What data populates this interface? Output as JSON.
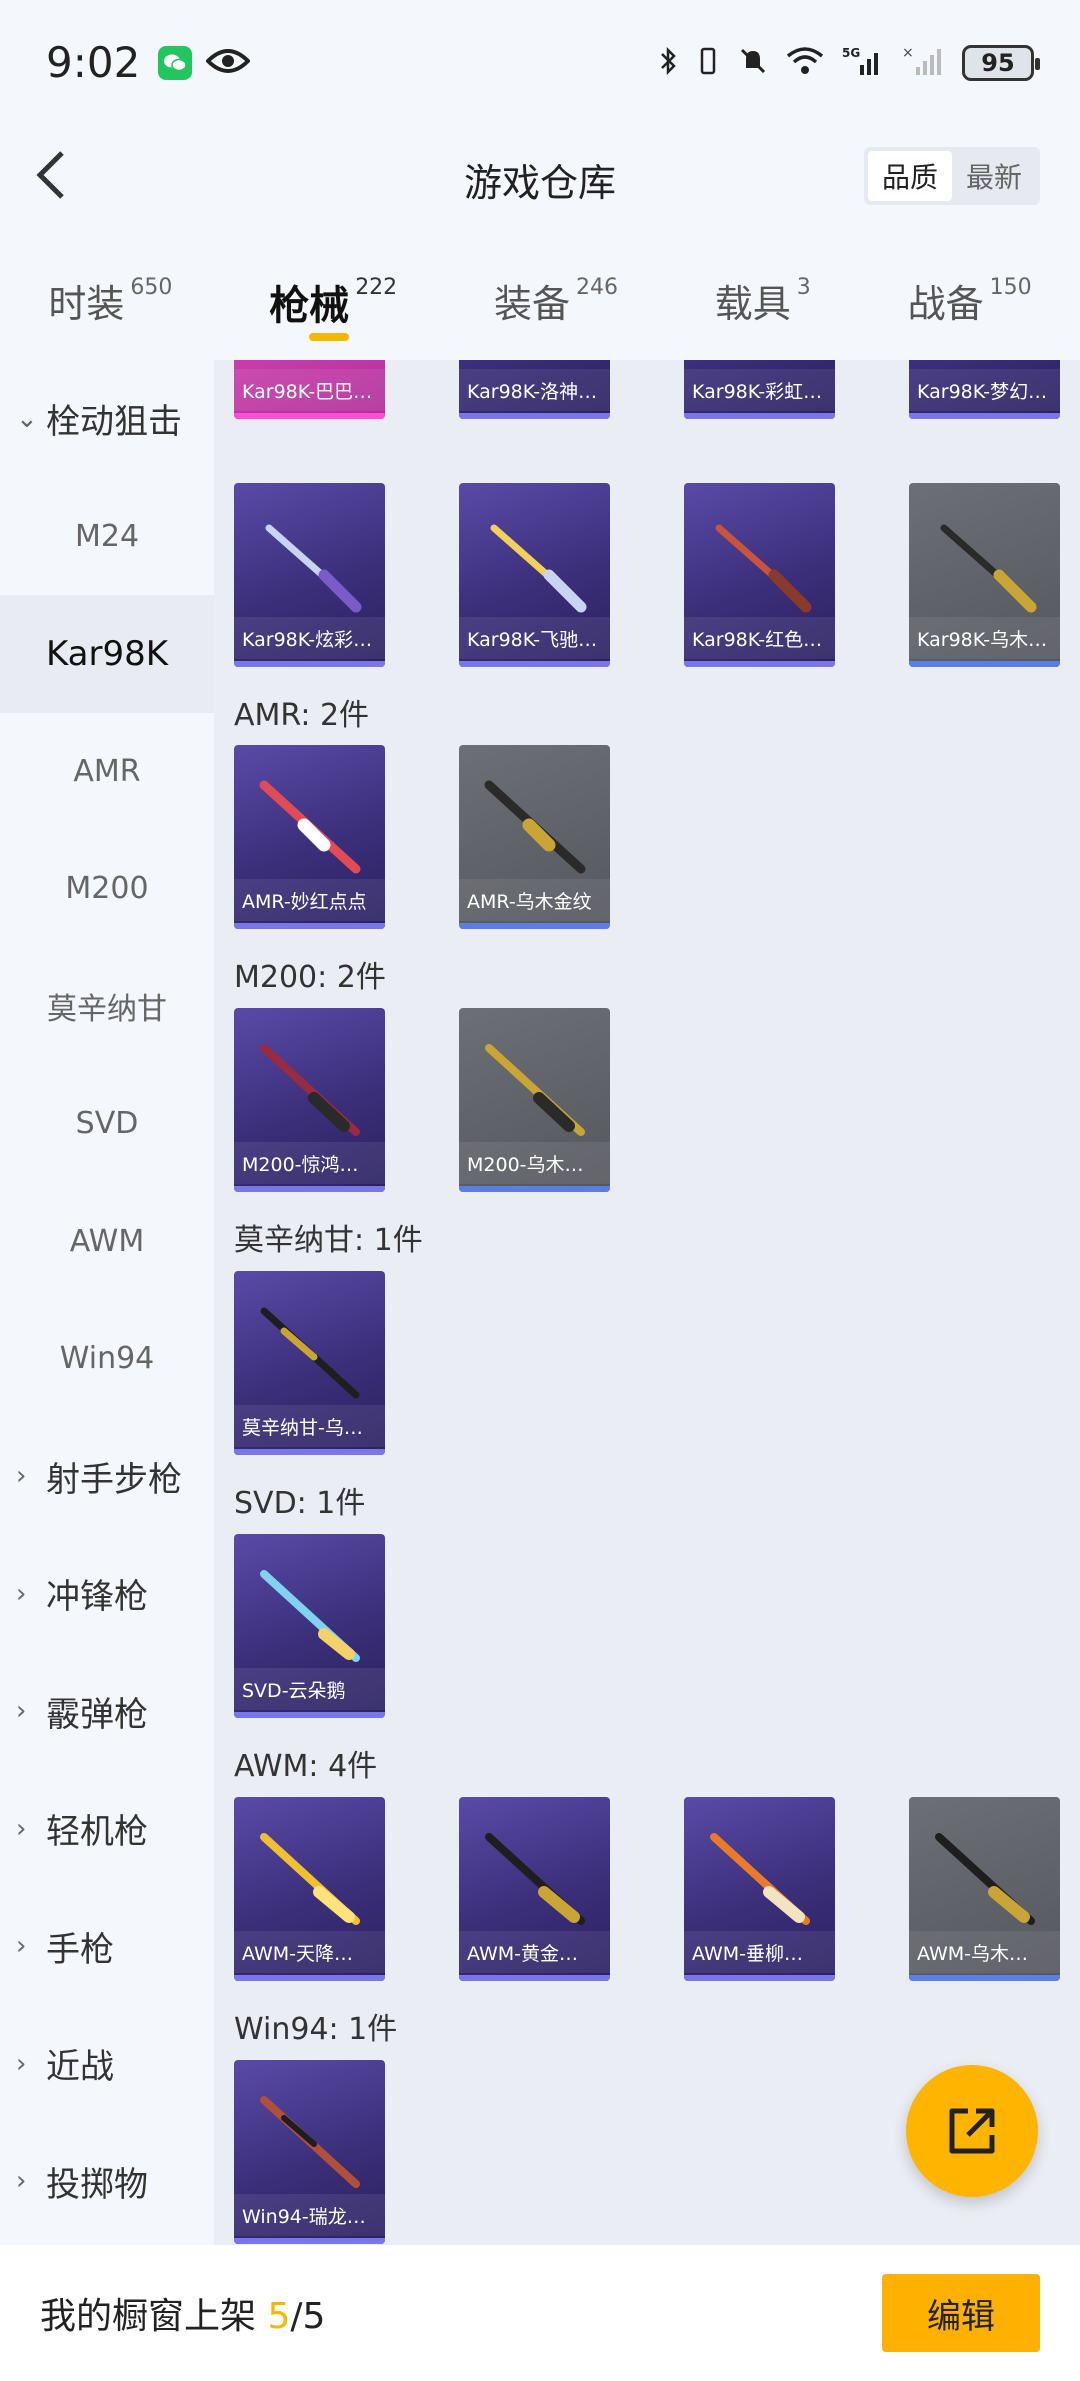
{
  "status_bar": {
    "time": "9:02",
    "battery": "95",
    "network": "5G"
  },
  "header": {
    "title": "游戏仓库",
    "sort_quality": "品质",
    "sort_newest": "最新"
  },
  "tabs": [
    {
      "label": "时装",
      "count": "650"
    },
    {
      "label": "枪械",
      "count": "222"
    },
    {
      "label": "装备",
      "count": "246"
    },
    {
      "label": "载具",
      "count": "3"
    },
    {
      "label": "战备",
      "count": "150"
    }
  ],
  "sidebar": {
    "group": "栓动狙击",
    "items": [
      "M24",
      "Kar98K",
      "AMR",
      "M200",
      "莫辛纳甘",
      "SVD",
      "AWM",
      "Win94"
    ],
    "groups": [
      "射手步枪",
      "冲锋枪",
      "霰弹枪",
      "轻机枪",
      "手枪",
      "近战",
      "投掷物"
    ]
  },
  "sections": {
    "kar98k_top": [
      "Kar98K-巴巴…",
      "Kar98K-洛神…",
      "Kar98K-彩虹…",
      "Kar98K-梦幻…"
    ],
    "kar98k": [
      "Kar98K-炫彩…",
      "Kar98K-飞驰…",
      "Kar98K-红色…",
      "Kar98K-乌木…"
    ],
    "amr_label": "AMR: 2件",
    "amr": [
      "AMR-妙红点点",
      "AMR-乌木金纹"
    ],
    "m200_label": "M200: 2件",
    "m200": [
      "M200-惊鸿…",
      "M200-乌木…"
    ],
    "mosin_label": "莫辛纳甘: 1件",
    "mosin": [
      "莫辛纳甘-乌…"
    ],
    "svd_label": "SVD: 1件",
    "svd": [
      "SVD-云朵鹅"
    ],
    "awm_label": "AWM: 4件",
    "awm": [
      "AWM-天降…",
      "AWM-黄金…",
      "AWM-垂柳…",
      "AWM-乌木…"
    ],
    "win94_label": "Win94: 1件",
    "win94": [
      "Win94-瑞龙…"
    ]
  },
  "bottom": {
    "prefix": "我的橱窗上架 ",
    "count": "5",
    "total": "/5",
    "edit": "编辑"
  },
  "colors": {
    "accent": "#f5b800",
    "card_purple": "#3b2f7a",
    "card_gray": "#5a5c63"
  }
}
